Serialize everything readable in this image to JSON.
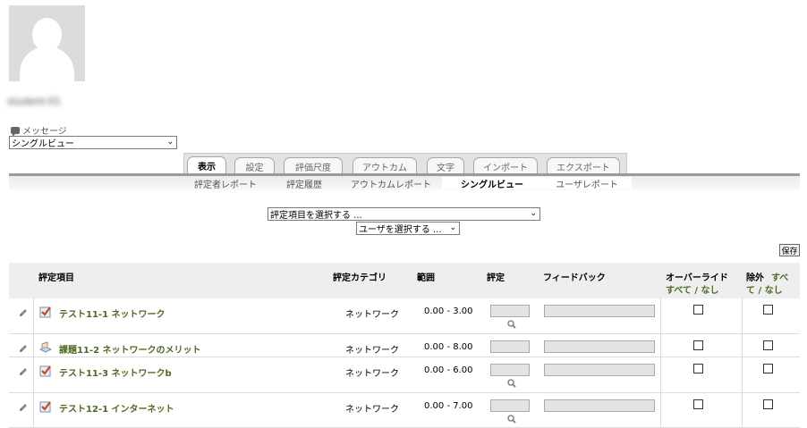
{
  "profile": {
    "username": "student-01"
  },
  "message_link": "メッセージ",
  "view_select": "シングルビュー",
  "tabs": [
    "表示",
    "設定",
    "評価尺度",
    "アウトカム",
    "文字",
    "インポート",
    "エクスポート"
  ],
  "subtabs": [
    "評定者レポート",
    "評定履歴",
    "アウトカムレポート",
    "シングルビュー",
    "ユーザレポート"
  ],
  "grade_item_select": "評定項目を選択する ...",
  "user_select": "ユーザを選択する ...",
  "save_label": "保存",
  "table": {
    "headers": {
      "item": "評定項目",
      "category": "評定カテゴリ",
      "range": "範囲",
      "grade": "評定",
      "feedback": "フィードバック",
      "override": "オーバーライド",
      "exclude": "除外"
    },
    "all_label": "すべて",
    "none_label": "なし",
    "exclude_all_a": "すべ",
    "exclude_all_b": "て",
    "slash": "/",
    "rows": [
      {
        "name": "テスト11-1 ネットワーク",
        "category": "ネットワーク",
        "range": "0.00 - 3.00",
        "type": "quiz"
      },
      {
        "name": "課題11-2 ネットワークのメリット",
        "category": "ネットワーク",
        "range": "0.00 - 8.00",
        "type": "assignment"
      },
      {
        "name": "テスト11-3 ネットワークb",
        "category": "ネットワーク",
        "range": "0.00 - 6.00",
        "type": "quiz"
      },
      {
        "name": "テスト12-1 インターネット",
        "category": "ネットワーク",
        "range": "0.00 - 7.00",
        "type": "quiz"
      }
    ]
  },
  "icons": {
    "edit": "pencil-icon",
    "quiz": "quiz-check-icon",
    "assignment": "assignment-icon",
    "search": "magnifier-icon",
    "message": "speech-bubble-icon"
  },
  "colors": {
    "link": "#4c6a1f",
    "header_bg": "#eeeeee"
  }
}
